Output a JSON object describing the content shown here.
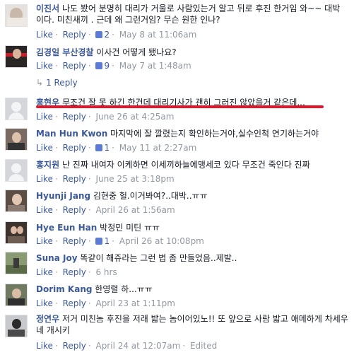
{
  "comments": [
    {
      "name": "이진서",
      "text": "나도 봤어 분명히 대리가 거울로 사람있는거 알고 뒤로 후진 한거임 와~~ 대박 이다. 미친새끼 . 근데 왜 그런거임? 무슨 원한 인나?",
      "like": "Like",
      "reply": "Reply",
      "likes": "2",
      "time": "May 8 at 11:06am",
      "edited": ""
    },
    {
      "name": "김경일 부산경찰",
      "text": "이사건 어떻게 됐나요?",
      "like": "Like",
      "reply": "Reply",
      "likes": "9",
      "time": "May 7 at 1:48am",
      "edited": ""
    },
    {
      "name": "홍현우",
      "text": "무조건 잘 못 하긴 한건데 대리기사가 괜히 그러진 않았을거 같은데...",
      "like": "Like",
      "reply": "Reply",
      "likes": "",
      "time": "June 26 at 4:25am",
      "edited": ""
    },
    {
      "name": "Man Hun Kwon",
      "text": "마지막에 잘 깔렸는지 확인하는거야,실수인척 연기하는거야",
      "like": "Like",
      "reply": "Reply",
      "likes": "1",
      "time": "May 11 at 2:27am",
      "edited": ""
    },
    {
      "name": "홍지원",
      "text": "난 진짜 내여자 이케하면 이세끼하늘에맹세코 있다 무조건 죽인다 진짜",
      "like": "Like",
      "reply": "Reply",
      "likes": "",
      "time": "June 25 at 3:18pm",
      "edited": ""
    },
    {
      "name": "Hyunji Jang",
      "text": "김현중 헐.이거봐여?..대박..ㅠㅠ",
      "like": "Like",
      "reply": "Reply",
      "likes": "",
      "time": "April 26 at 1:56am",
      "edited": ""
    },
    {
      "name": "Hye Eun Han",
      "text": "박정민 미틴 ㅠㅠ",
      "like": "Like",
      "reply": "Reply",
      "likes": "1",
      "time": "April 26 at 10:08pm",
      "edited": ""
    },
    {
      "name": "Suna Joy",
      "text": "똑같이 해쥬라는 그런 법 좀 만들었음..제발..",
      "like": "Like",
      "reply": "Reply",
      "likes": "",
      "time": "6 hrs",
      "edited": ""
    },
    {
      "name": "Dorim Kang",
      "text": "한영렬 하...ㅠㅠ",
      "like": "Like",
      "reply": "Reply",
      "likes": "",
      "time": "April 23 at 1:11pm",
      "edited": ""
    },
    {
      "name": "정연우",
      "text": "저거 미친놈 후진을 저래 밟는 놈이어있노!! 또 앞으로 사람 밟고 애메하게 차세우네 개시키",
      "like": "Like",
      "reply": "Reply",
      "likes": "",
      "time": "April 24 at 12:07am",
      "edited": "Edited"
    }
  ],
  "reply_link": {
    "count_label": "1 Reply",
    "arrow": "↳"
  },
  "colors": {
    "link": "#3b5998",
    "meta": "#9197a3",
    "highlight": "#e2182a"
  }
}
